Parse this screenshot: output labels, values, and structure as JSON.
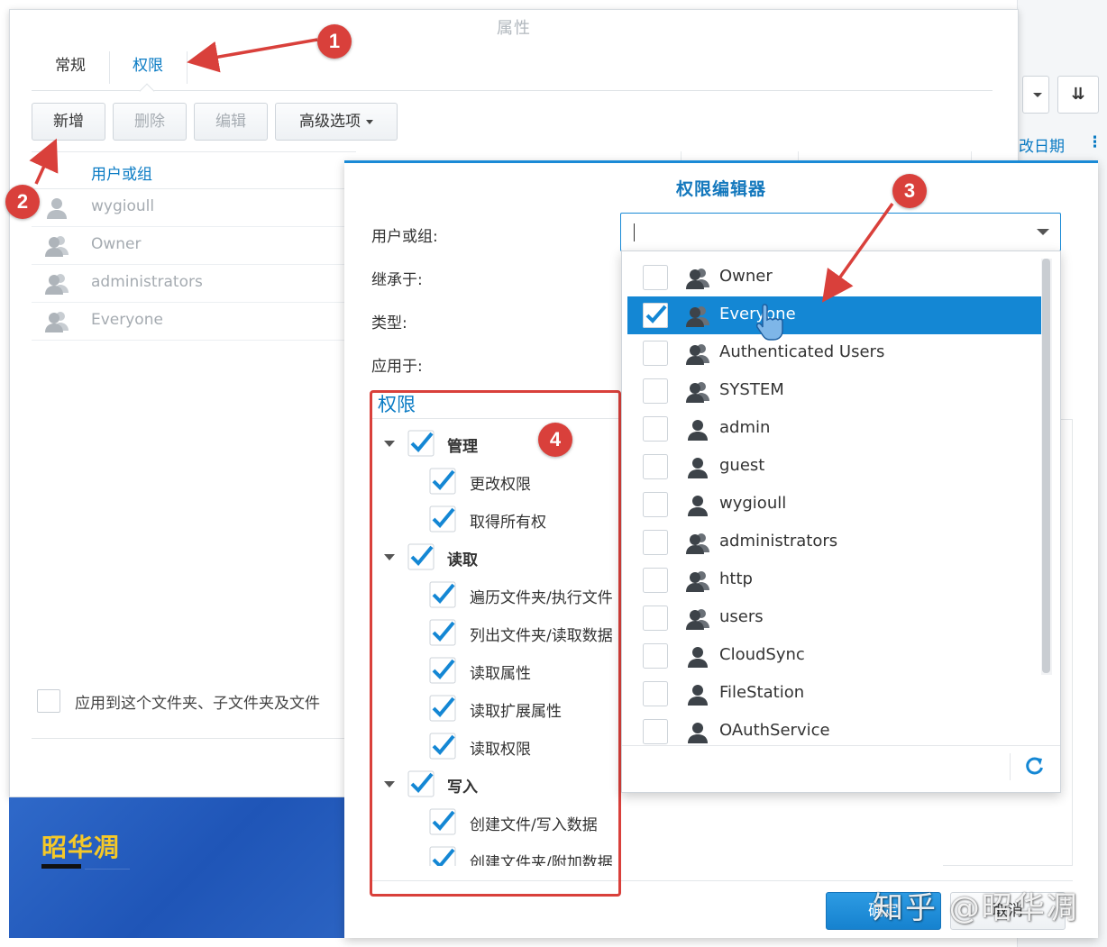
{
  "properties": {
    "title": "属性",
    "tabs": [
      "常规",
      "权限"
    ],
    "toolbar": {
      "add": "新增",
      "delete": "删除",
      "edit": "编辑",
      "advanced": "高级选项"
    },
    "list_header": "用户或组",
    "rows": [
      {
        "name": "wygioull",
        "icon": "user-icon"
      },
      {
        "name": "Owner",
        "icon": "group-icon"
      },
      {
        "name": "administrators",
        "icon": "group-icon"
      },
      {
        "name": "Everyone",
        "icon": "group-icon"
      }
    ],
    "apply_label": "应用到这个文件夹、子文件夹及文件"
  },
  "background_window": {
    "date_column": "改日期",
    "more": "⋮"
  },
  "banner": {
    "logo": "昭华凋"
  },
  "editor": {
    "title": "权限编辑器",
    "labels": {
      "user_or_group": "用户或组:",
      "inherited": "继承于:",
      "type": "类型:",
      "apply_to": "应用于:"
    },
    "combo_value": "",
    "permissions_title": "权限",
    "groups": [
      {
        "label": "管理",
        "checked": true,
        "items": [
          {
            "label": "更改权限",
            "checked": true
          },
          {
            "label": "取得所有权",
            "checked": true
          }
        ]
      },
      {
        "label": "读取",
        "checked": true,
        "items": [
          {
            "label": "遍历文件夹/执行文件",
            "checked": true
          },
          {
            "label": "列出文件夹/读取数据",
            "checked": true
          },
          {
            "label": "读取属性",
            "checked": true
          },
          {
            "label": "读取扩展属性",
            "checked": true
          },
          {
            "label": "读取权限",
            "checked": true
          }
        ]
      },
      {
        "label": "写入",
        "checked": true,
        "items": [
          {
            "label": "创建文件/写入数据",
            "checked": true
          },
          {
            "label": "创建文件夹/附加数据",
            "checked": true
          }
        ]
      }
    ],
    "ok": "确定",
    "cancel": "取消"
  },
  "dropdown": {
    "items": [
      {
        "name": "Owner",
        "icon": "group-icon",
        "checked": false,
        "selected": false
      },
      {
        "name": "Everyone",
        "icon": "group-icon",
        "checked": true,
        "selected": true
      },
      {
        "name": "Authenticated Users",
        "icon": "group-icon",
        "checked": false,
        "selected": false
      },
      {
        "name": "SYSTEM",
        "icon": "group-icon",
        "checked": false,
        "selected": false
      },
      {
        "name": "admin",
        "icon": "user-icon",
        "checked": false,
        "selected": false
      },
      {
        "name": "guest",
        "icon": "user-icon",
        "checked": false,
        "selected": false
      },
      {
        "name": "wygioull",
        "icon": "user-icon",
        "checked": false,
        "selected": false
      },
      {
        "name": "administrators",
        "icon": "group-icon",
        "checked": false,
        "selected": false
      },
      {
        "name": "http",
        "icon": "group-icon",
        "checked": false,
        "selected": false
      },
      {
        "name": "users",
        "icon": "group-icon",
        "checked": false,
        "selected": false
      },
      {
        "name": "CloudSync",
        "icon": "user-icon",
        "checked": false,
        "selected": false
      },
      {
        "name": "FileStation",
        "icon": "user-icon",
        "checked": false,
        "selected": false
      },
      {
        "name": "OAuthService",
        "icon": "user-icon",
        "checked": false,
        "selected": false
      }
    ]
  },
  "annotations": [
    "1",
    "2",
    "3",
    "4"
  ],
  "watermark": "知乎 @昭华凋",
  "colors": {
    "accent": "#0a7bc4",
    "selection": "#1487d4",
    "annotation": "#d9403b"
  }
}
